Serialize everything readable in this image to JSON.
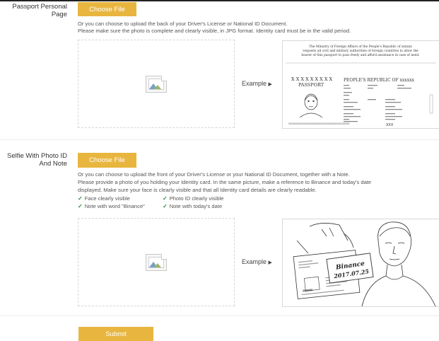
{
  "passport_section": {
    "label_line1": "Passport Personal",
    "label_line2": "Page",
    "choose_file_label": "Choose File",
    "instruction_line1": "Or you can choose to upload the back of your Driver's License or National ID Document.",
    "instruction_line2": "Please make sure the photo is complete and clearly visible, in JPG format. Identity card must be in the valid period.",
    "example_label": "Example",
    "example_image": {
      "header_line1": "The Ministry of Foreign Affairs of the People's Republic of xxxxxx",
      "header_line2": "requests all civil and military authorities of foreign countries to allow the",
      "header_line3": "bearer  of  this passport to pass freely and afford assistance in case of need.",
      "passport_word": "PASSPORT",
      "xs": "X X X X X X X X X",
      "country": "PEOPLE'S REPUBLIC OF xxxxxx",
      "mrz": "XXXXXXXXXXXXXXXXXXXXXXXXXXXXXXXXXXXXXXXXXXXXX",
      "xxx": "XXX"
    }
  },
  "selfie_section": {
    "label_line1": "Selfie With Photo ID",
    "label_line2": "And Note",
    "choose_file_label": "Choose File",
    "instruction_line1": "Or you can choose to upload the front of your Driver's License or your National ID Document, together with a Note.",
    "instruction_line2": "Please provide a photo of you holding your Identity card. In the same picture, make a reference to Binance and today's date",
    "instruction_line3": "displayed. Make sure your face is clearly visible and that all Identity card details are clearly readable.",
    "checks": [
      "Face clearly visible",
      "Photo ID clearly visible",
      "Note with word \"Binance\"",
      "Note with today's date"
    ],
    "example_label": "Example",
    "example_image": {
      "note_word": "Binance",
      "note_date": "2017.07.25"
    }
  },
  "submit_label": "Submit",
  "colors": {
    "accent": "#e8b63f",
    "check": "#2e8b3a"
  }
}
